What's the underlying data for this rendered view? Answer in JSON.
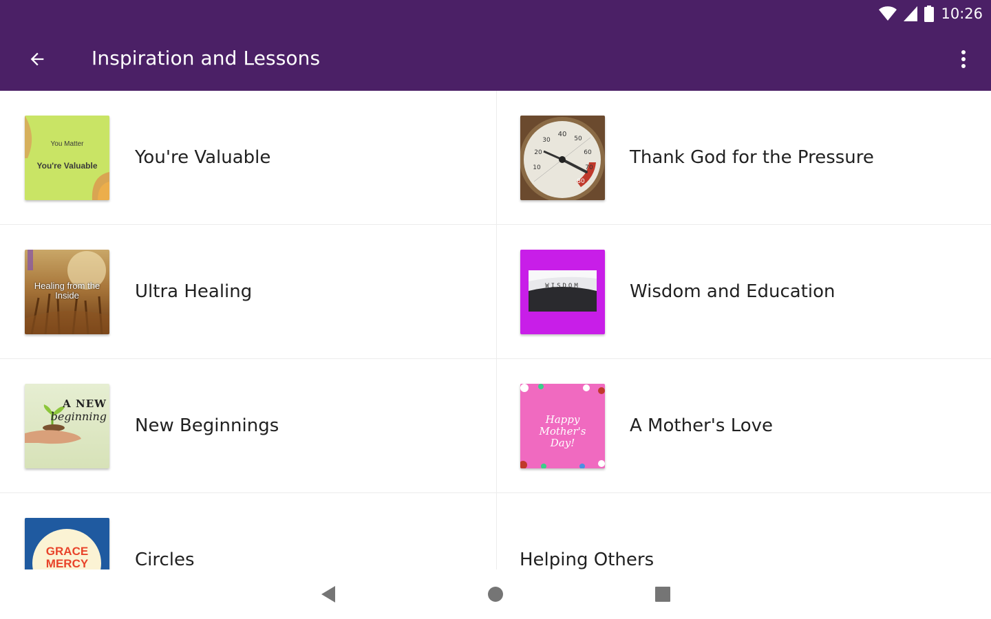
{
  "status_bar": {
    "time": "10:26"
  },
  "toolbar": {
    "title": "Inspiration and Lessons"
  },
  "colors": {
    "appbar": "#4b2066",
    "text": "#212121",
    "divider": "#ececec"
  },
  "tiles": [
    {
      "label": "You're Valuable",
      "thumb_text": [
        "You Matter",
        "You're Valuable"
      ]
    },
    {
      "label": "Thank God for the Pressure",
      "thumb_text": [
        "40",
        "50",
        "30",
        "60",
        "20",
        "70",
        "10",
        "80"
      ]
    },
    {
      "label": "Ultra Healing",
      "thumb_text": [
        "Healing from the Inside"
      ]
    },
    {
      "label": "Wisdom and Education",
      "thumb_text": [
        "WISDOM"
      ]
    },
    {
      "label": "New Beginnings",
      "thumb_text": [
        "A NEW",
        "beginning"
      ]
    },
    {
      "label": "A Mother's Love",
      "thumb_text": [
        "Happy Mother's Day!"
      ]
    },
    {
      "label": "Circles",
      "thumb_text": [
        "GRACE",
        "MERCY"
      ]
    },
    {
      "label": "Helping Others"
    }
  ],
  "icons": {
    "back": "arrow-back-icon",
    "overflow": "more-vert-icon",
    "wifi": "wifi-icon",
    "signal": "cell-signal-icon",
    "battery": "battery-icon",
    "nav_back": "nav-back-icon",
    "nav_home": "nav-home-icon",
    "nav_recents": "nav-recents-icon"
  }
}
